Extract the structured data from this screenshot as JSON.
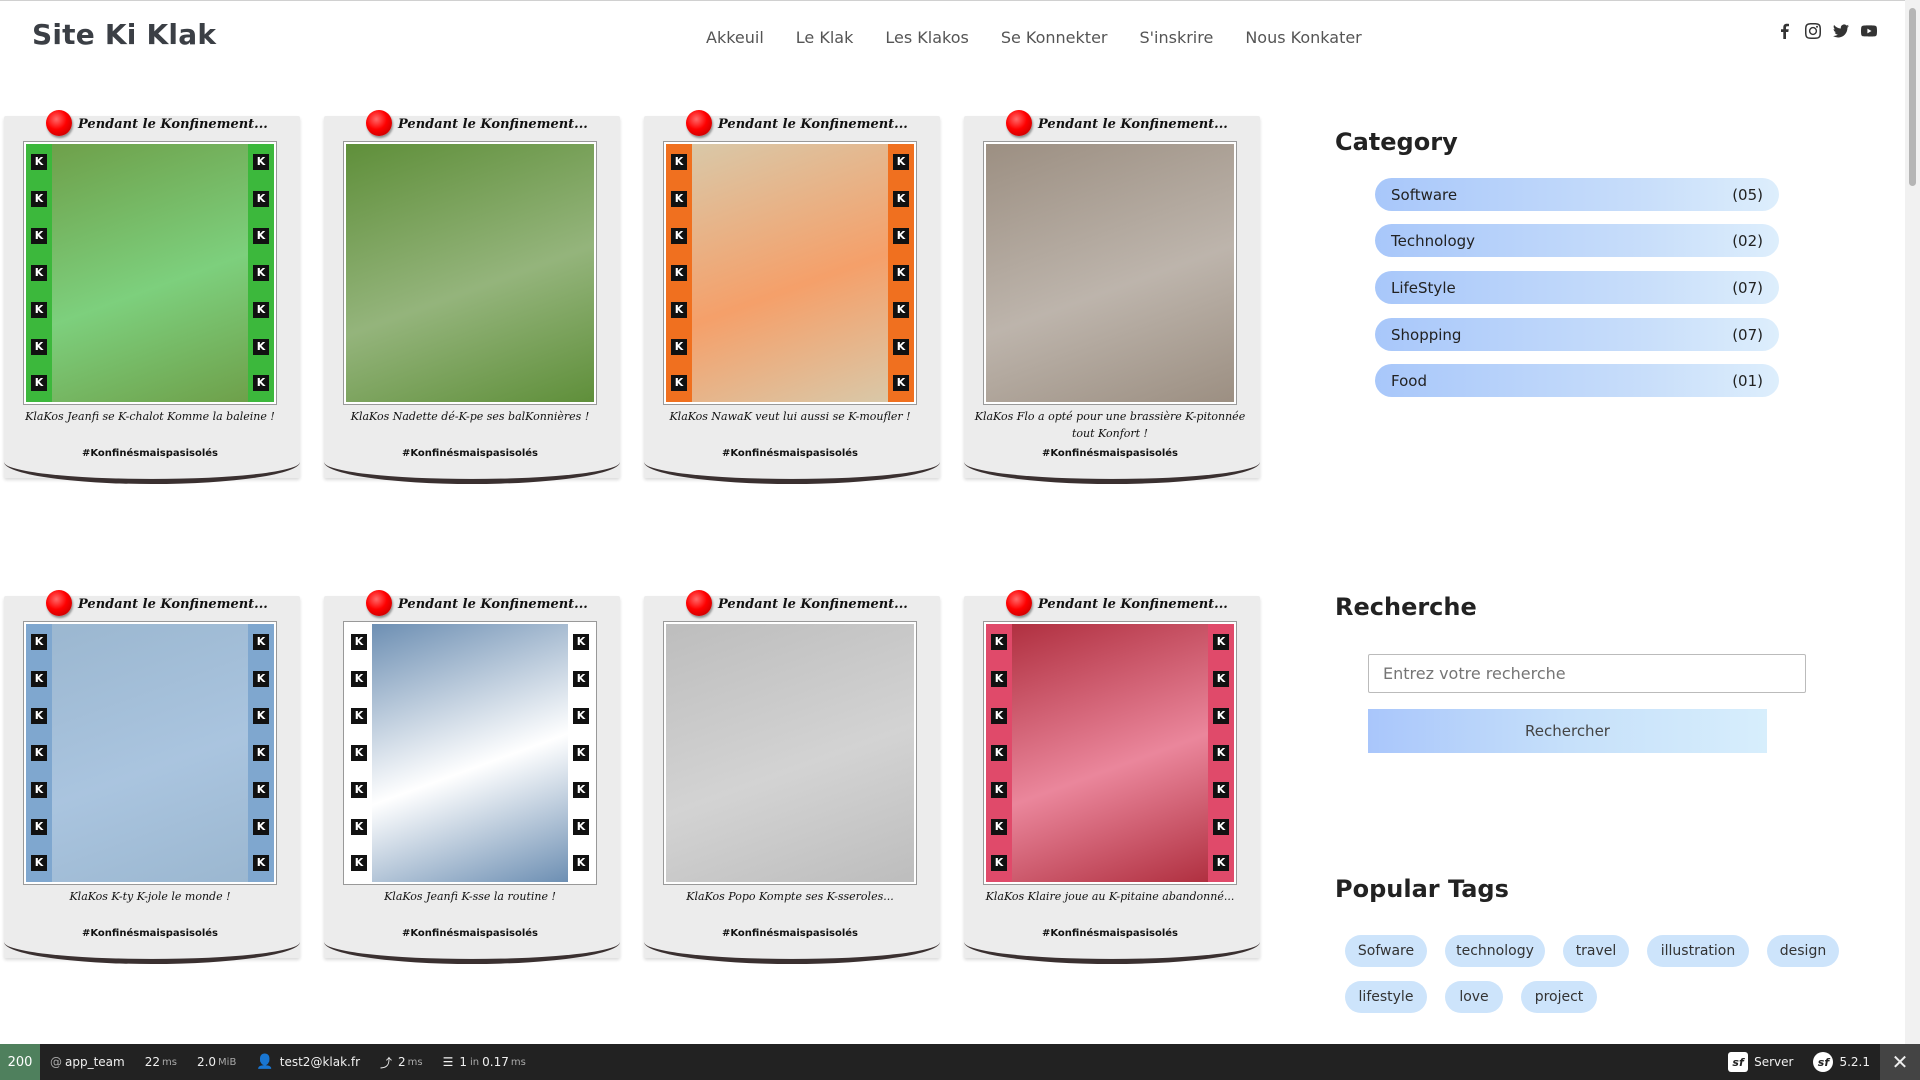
{
  "header": {
    "brand": "Site Ki Klak",
    "nav": [
      "Akkeuil",
      "Le Klak",
      "Les Klakos",
      "Se Konnekter",
      "S'inskrire",
      "Nous Konkater"
    ],
    "social": [
      "facebook-icon",
      "instagram-icon",
      "twitter-icon",
      "youtube-icon"
    ]
  },
  "cards": [
    {
      "heading": "Pendant le Konfinement...",
      "caption": "KlaKos Jeanfi se K-chalot Komme la baleine !",
      "tag": "#Konfinésmaispasisolés",
      "strip_color": "#3cb83c",
      "bg": "#6ea04a"
    },
    {
      "heading": "Pendant le Konfinement...",
      "caption": "KlaKos Nadette dé-K-pe ses balKonnières !",
      "tag": "#Konfinésmaispasisolés",
      "strip_color": "",
      "bg": "#5f8f3a"
    },
    {
      "heading": "Pendant le Konfinement...",
      "caption": "KlaKos NawaK veut lui aussi se K-moufler !",
      "tag": "#Konfinésmaispasisolés",
      "strip_color": "#f0701f",
      "bg": "#d9c8a8"
    },
    {
      "heading": "Pendant le Konfinement...",
      "caption": "KlaKos Flo a opté pour une brassière K-pitonnée tout Konfort !",
      "tag": "#Konfinésmaispasisolés",
      "strip_color": "",
      "bg": "#9c8f82"
    },
    {
      "heading": "Pendant le Konfinement...",
      "caption": "KlaKos K-ty K-jole le monde !",
      "tag": "#Konfinésmaispasisolés",
      "strip_color": "#7fa7cf",
      "bg": "#9bb7d0"
    },
    {
      "heading": "Pendant le Konfinement...",
      "caption": "KlaKos Jeanfi K-sse la routine !",
      "tag": "#Konfinésmaispasisolés",
      "strip_color": "#ffffff",
      "bg": "#6d8fb3"
    },
    {
      "heading": "Pendant le Konfinement...",
      "caption": "KlaKos Popo Kompte ses K-sseroles...",
      "tag": "#Konfinésmaispasisolés",
      "strip_color": "",
      "bg": "#bdbdbd"
    },
    {
      "heading": "Pendant le Konfinement...",
      "caption": "KlaKos Klaire joue au K-pitaine abandonné...",
      "tag": "#Konfinésmaispasisolés",
      "strip_color": "#e04a6a",
      "bg": "#b03040"
    }
  ],
  "sidebar": {
    "category_title": "Category",
    "categories": [
      {
        "label": "Software",
        "count": "(05)"
      },
      {
        "label": "Technology",
        "count": "(02)"
      },
      {
        "label": "LifeStyle",
        "count": "(07)"
      },
      {
        "label": "Shopping",
        "count": "(07)"
      },
      {
        "label": "Food",
        "count": "(01)"
      }
    ],
    "search_title": "Recherche",
    "search_placeholder": "Entrez votre recherche",
    "search_button": "Rechercher",
    "tags_title": "Popular Tags",
    "tags": [
      "Sofware",
      "technology",
      "travel",
      "illustration",
      "design",
      "lifestyle",
      "love",
      "project"
    ]
  },
  "toolbar": {
    "status": "200",
    "route": "app_team",
    "time": "22",
    "time_unit": "ms",
    "memory": "2.0",
    "memory_unit": "MiB",
    "user": "test2@klak.fr",
    "ajax": "2",
    "ajax_unit": "ms",
    "db": "1",
    "db_in": "in",
    "db_time": "0.17",
    "db_unit": "ms",
    "server": "Server",
    "version": "5.2.1"
  }
}
